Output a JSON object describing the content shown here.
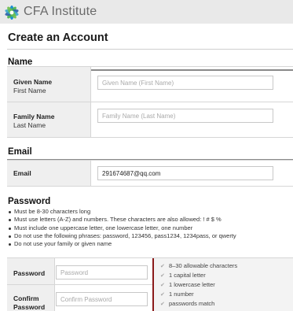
{
  "header": {
    "brand": "CFA Institute",
    "logo_icon": "cfa-logo-icon",
    "colors": {
      "bar": "#e9e9e9",
      "brand_text": "#6a6a6a"
    }
  },
  "page": {
    "title": "Create an Account"
  },
  "name_section": {
    "heading": "Name",
    "given": {
      "label": "Given Name",
      "sublabel": "First Name",
      "placeholder": "Given Name (First Name)",
      "value": ""
    },
    "family": {
      "label": "Family Name",
      "sublabel": "Last Name",
      "placeholder": "Family Name (Last Name)",
      "value": ""
    }
  },
  "email_section": {
    "heading": "Email",
    "email": {
      "label": "Email",
      "value": "291674687@qq.com"
    }
  },
  "password_section": {
    "heading": "Password",
    "rules": [
      "Must be 8-30 characters long",
      "Must use letters (A-Z) and numbers. These characters are also allowed: ! # $ %",
      "Must include one uppercase letter, one lowercase letter, one number",
      "Do not use the following phrases: password, 123456, pass1234, 1234pass, or qwerty",
      "Do not use your family or given name"
    ],
    "password": {
      "label": "Password",
      "placeholder": "Password"
    },
    "confirm": {
      "label_line1": "Confirm",
      "label_line2": "Password",
      "placeholder": "Confirm Password"
    },
    "checklist": [
      "8–30 allowable characters",
      "1 capital letter",
      "1 lowercase letter",
      "1 number",
      "passwords match"
    ],
    "check_icon": "check-icon",
    "accent_color": "#8b1a1a"
  }
}
